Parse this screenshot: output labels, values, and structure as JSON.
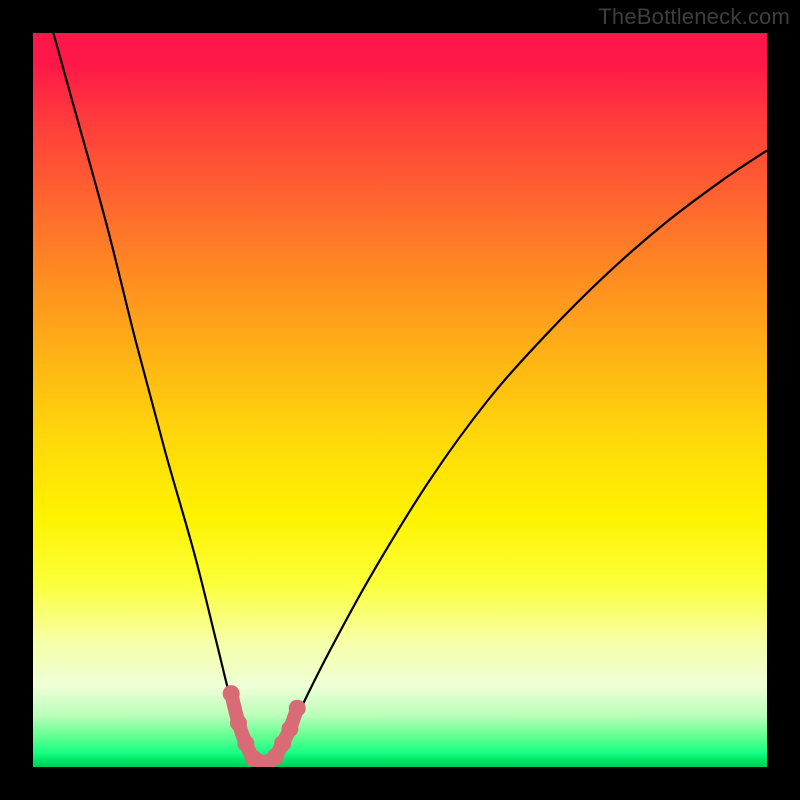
{
  "watermark": "TheBottleneck.com",
  "chart_data": {
    "type": "line",
    "title": "",
    "xlabel": "",
    "ylabel": "",
    "xlim": [
      0,
      100
    ],
    "ylim": [
      0,
      100
    ],
    "grid": false,
    "legend": false,
    "series": [
      {
        "name": "bottleneck-curve",
        "x": [
          0,
          5,
          10,
          14,
          18,
          22,
          25,
          27,
          29,
          30.5,
          32,
          34,
          36,
          40,
          46,
          54,
          62,
          70,
          78,
          86,
          94,
          100
        ],
        "values": [
          110,
          92,
          74,
          58,
          43,
          29,
          17,
          9,
          3,
          0.5,
          0.5,
          3,
          7,
          15,
          26,
          39,
          50,
          59,
          67,
          74,
          80,
          84
        ]
      }
    ],
    "highlight": {
      "name": "optimal-range",
      "x": [
        27,
        28,
        29,
        30,
        31,
        32,
        33,
        34,
        35,
        36
      ],
      "values": [
        10,
        6,
        3.2,
        1.2,
        0.6,
        0.6,
        1.4,
        3.2,
        5.2,
        8
      ]
    },
    "background_gradient": {
      "top_color": "#ff1749",
      "mid_color": "#fff300",
      "bottom_color": "#00cd58",
      "description": "red-yellow-green vertical gradient (high bottleneck at top, zero at bottom)"
    }
  }
}
